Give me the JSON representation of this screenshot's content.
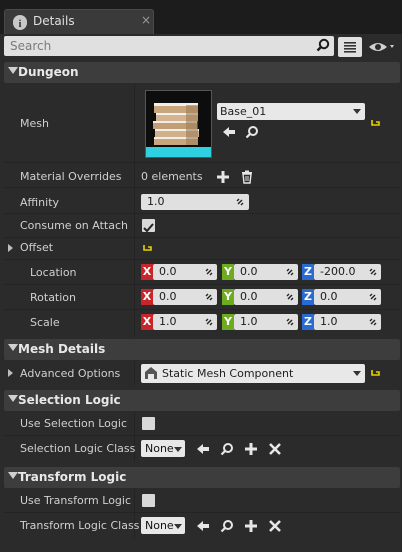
{
  "tab": {
    "title": "Details",
    "close": "×"
  },
  "search": {
    "placeholder": "Search"
  },
  "categories": {
    "dungeon": "Dungeon",
    "mesh_details": "Mesh Details",
    "selection_logic": "Selection Logic",
    "transform_logic": "Transform Logic"
  },
  "dungeon": {
    "mesh": {
      "label": "Mesh",
      "value": "Base_01"
    },
    "material_overrides": {
      "label": "Material Overrides",
      "value": "0 elements"
    },
    "affinity": {
      "label": "Affinity",
      "value": "1.0"
    },
    "consume_on_attach": {
      "label": "Consume on Attach",
      "checked": true
    },
    "offset": {
      "label": "Offset",
      "location": {
        "label": "Location",
        "x": "0.0",
        "y": "0.0",
        "z": "-200.0"
      },
      "rotation": {
        "label": "Rotation",
        "x": "0.0",
        "y": "0.0",
        "z": "0.0"
      },
      "scale": {
        "label": "Scale",
        "x": "1.0",
        "y": "1.0",
        "z": "1.0"
      }
    }
  },
  "axes": {
    "x": "X",
    "y": "Y",
    "z": "Z"
  },
  "mesh_details": {
    "advanced_options": {
      "label": "Advanced Options",
      "value": "Static Mesh Component"
    }
  },
  "selection_logic": {
    "use": {
      "label": "Use Selection Logic",
      "checked": false
    },
    "class": {
      "label": "Selection Logic Class",
      "value": "None"
    }
  },
  "transform_logic": {
    "use": {
      "label": "Use Transform Logic",
      "checked": false
    },
    "class": {
      "label": "Transform Logic Class",
      "value": "None"
    }
  },
  "colors": {
    "x_axis": "#c7262a",
    "y_axis": "#6dab1f",
    "z_axis": "#2a6bd1",
    "reset_yellow": "#e8d000"
  }
}
